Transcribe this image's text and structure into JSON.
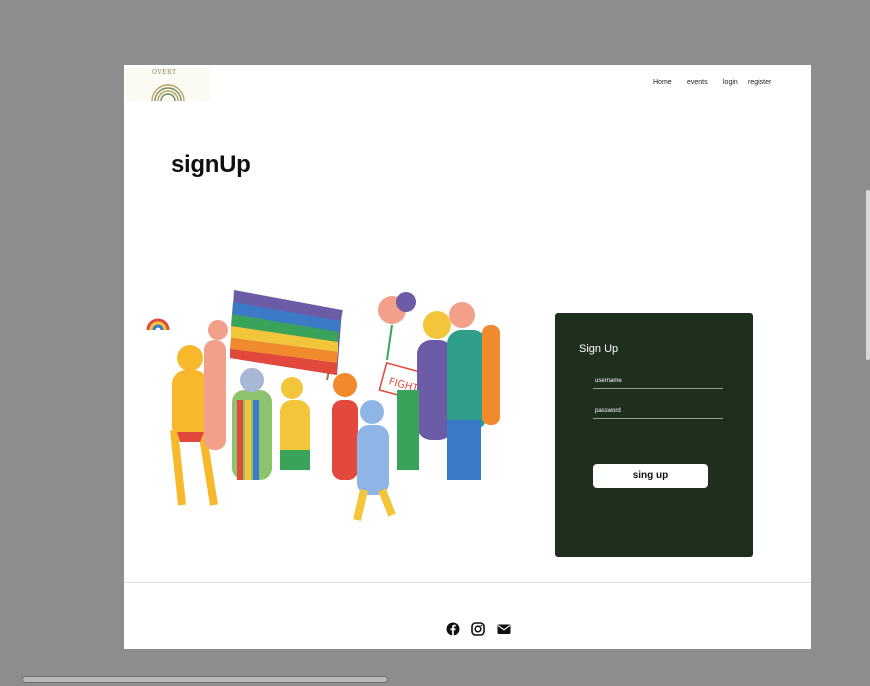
{
  "header": {
    "logo_text": "OVERT",
    "nav": {
      "home": "Home",
      "events": "events",
      "login": "login",
      "register": "register"
    }
  },
  "main": {
    "page_title": "signUp",
    "illustration_sign_text": "FIGHT BACK"
  },
  "signup_card": {
    "title": "Sign Up",
    "username_label": "username",
    "password_label": "password",
    "submit_label": "sing up"
  },
  "footer": {
    "icons": [
      "facebook-icon",
      "instagram-icon",
      "envelope-icon"
    ]
  },
  "colors": {
    "card_bg": "#1e2f1e",
    "page_bg": "#ffffff",
    "desktop_bg": "#8d8d8d"
  }
}
